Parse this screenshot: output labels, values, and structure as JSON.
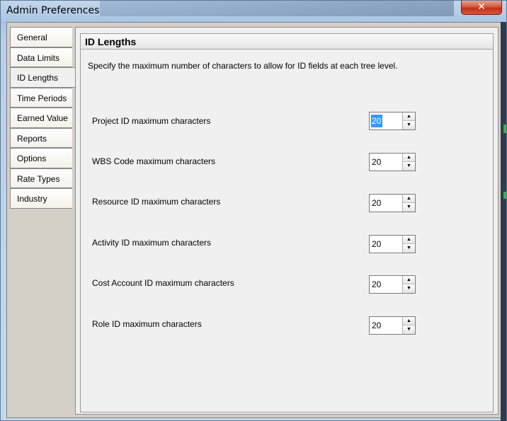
{
  "window": {
    "title": "Admin Preferences",
    "close_glyph": "✕"
  },
  "tabs": [
    {
      "label": "General",
      "mnemonic": "G"
    },
    {
      "label": "Data Limits",
      "mnemonic": "D"
    },
    {
      "label": "ID Lengths",
      "mnemonic": "L",
      "selected": true
    },
    {
      "label": "Time Periods",
      "mnemonic": "i"
    },
    {
      "label": "Earned Value",
      "mnemonic": "V"
    },
    {
      "label": "Reports",
      "mnemonic": "R"
    },
    {
      "label": "Options",
      "mnemonic": "O"
    },
    {
      "label": "Rate Types",
      "mnemonic": "a"
    },
    {
      "label": "Industry",
      "mnemonic": "I"
    }
  ],
  "panel": {
    "title": "ID Lengths",
    "description": "Specify the maximum number of characters to allow  for ID fields at each tree level."
  },
  "fields": [
    {
      "label": "Project ID maximum characters",
      "value": "20",
      "focused": true
    },
    {
      "label": "WBS Code maximum characters",
      "value": "20"
    },
    {
      "label": "Resource ID maximum characters",
      "value": "20"
    },
    {
      "label": "Activity ID maximum characters",
      "value": "20"
    },
    {
      "label": "Cost Account ID maximum characters",
      "value": "20"
    },
    {
      "label": "Role ID maximum characters",
      "value": "20"
    }
  ],
  "colors": {
    "selection": "#3399ff",
    "close_button": "#c2321a",
    "dialog_bg": "#f0f0f0"
  }
}
